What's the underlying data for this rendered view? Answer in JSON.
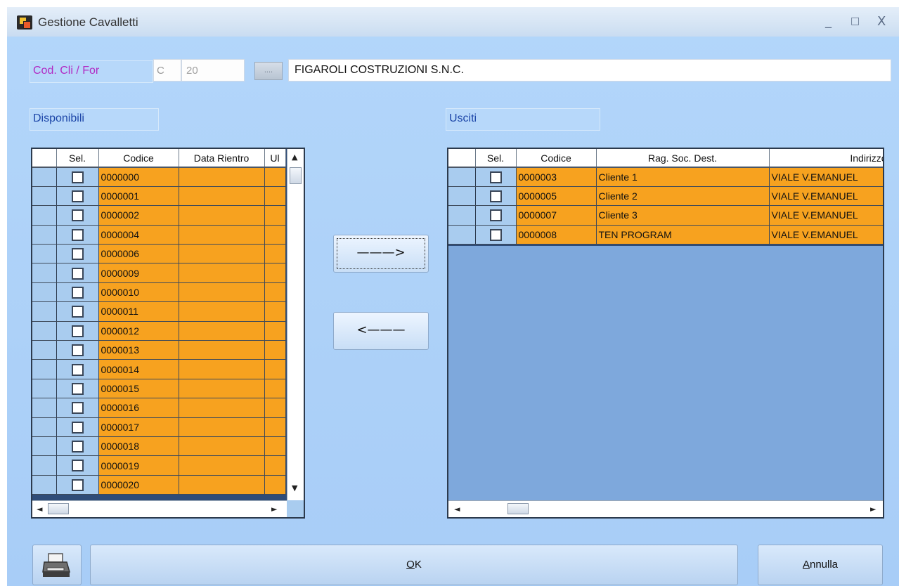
{
  "window": {
    "title": "Gestione Cavalletti",
    "controls": [
      "_",
      "□",
      "X"
    ]
  },
  "header": {
    "code_label": "Cod. Cli / For",
    "code_prefix": "C",
    "code_value": "20",
    "lookup_label": "....",
    "customer_name": "FIGAROLI COSTRUZIONI S.N.C."
  },
  "left": {
    "title": "Disponibili",
    "columns": [
      "Sel.",
      "Codice",
      "Data Rientro",
      "Ul"
    ],
    "rows": [
      "0000000",
      "0000001",
      "0000002",
      "0000004",
      "0000006",
      "0000009",
      "0000010",
      "0000011",
      "0000012",
      "0000013",
      "0000014",
      "0000015",
      "0000016",
      "0000017",
      "0000018",
      "0000019",
      "0000020"
    ]
  },
  "right": {
    "title": "Usciti",
    "columns": [
      "Sel.",
      "Codice",
      "Rag. Soc. Dest.",
      "Indirizzo D"
    ],
    "rows": [
      {
        "codice": "0000003",
        "rag": "Cliente 1",
        "ind": "VIALE V.EMANUEL"
      },
      {
        "codice": "0000005",
        "rag": "Cliente 2",
        "ind": "VIALE V.EMANUEL"
      },
      {
        "codice": "0000007",
        "rag": "Cliente 3",
        "ind": "VIALE V.EMANUEL"
      },
      {
        "codice": "0000008",
        "rag": "TEN PROGRAM",
        "ind": "VIALE V.EMANUEL"
      }
    ]
  },
  "buttons": {
    "move_right": "———>",
    "move_left": "<———",
    "ok_key": "O",
    "ok_rest": "K",
    "cancel_key": "A",
    "cancel_rest": "nnulla"
  },
  "colors": {
    "row_orange": "#f7a21f",
    "window_bg": "#b3d6fa",
    "empty_grid": "#7ea8dc"
  },
  "icons": [
    "app-icon",
    "printer-icon",
    "scroll-up-icon",
    "scroll-down-icon",
    "scroll-left-icon",
    "scroll-right-icon"
  ]
}
